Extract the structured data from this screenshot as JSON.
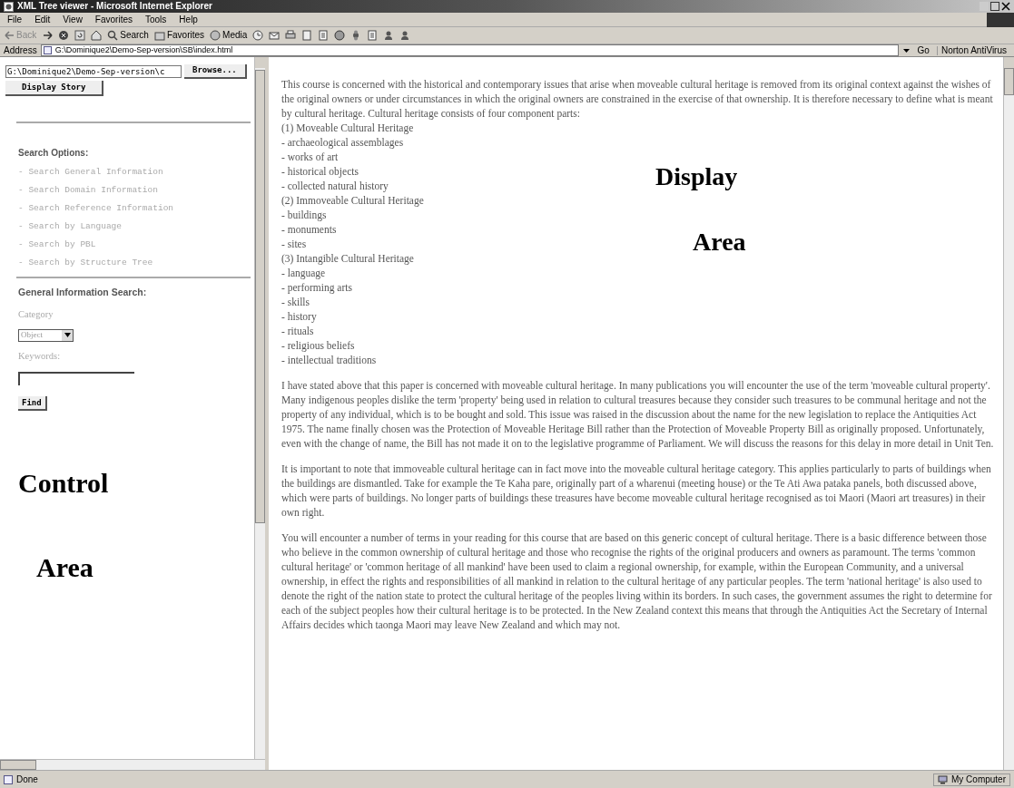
{
  "window": {
    "title": "XML Tree viewer - Microsoft Internet Explorer"
  },
  "menu": [
    "File",
    "Edit",
    "View",
    "Favorites",
    "Tools",
    "Help"
  ],
  "toolbar": [
    {
      "kind": "back",
      "label": "Back"
    },
    {
      "kind": "forward"
    },
    {
      "kind": "stop"
    },
    {
      "kind": "refresh"
    },
    {
      "kind": "home"
    },
    {
      "kind": "search",
      "label": "Search"
    },
    {
      "kind": "favorites",
      "label": "Favorites"
    },
    {
      "kind": "media",
      "label": "Media"
    },
    {
      "kind": "history"
    },
    {
      "kind": "mail"
    },
    {
      "kind": "print"
    },
    {
      "kind": "edit"
    },
    {
      "kind": "page"
    },
    {
      "kind": "globe"
    },
    {
      "kind": "flower"
    },
    {
      "kind": "page"
    },
    {
      "kind": "person"
    },
    {
      "kind": "person"
    }
  ],
  "address": {
    "label": "Address",
    "value": "G:\\Dominique2\\Demo-Sep-version\\SB\\index.html",
    "go": "Go",
    "extra": "Norton AntiVirus"
  },
  "control_frame": {
    "file_field": "G:\\Dominique2\\Demo-Sep-version\\c",
    "browse": "Browse...",
    "display_story": "Display Story",
    "search_options": {
      "heading": "Search Options:",
      "items": [
        "- Search General Information",
        "- Search Domain Information",
        "- Search Reference Information",
        "- Search by Language",
        "- Search by PBL",
        "- Search by Structure Tree"
      ]
    },
    "general_search": {
      "heading": "General Information Search:",
      "category_label": "Category",
      "category_value": "Object",
      "keywords_label": "Keywords:",
      "find": "Find"
    }
  },
  "display_frame": {
    "intro": "This course is concerned with the historical and contemporary issues that arise when moveable cultural heritage is removed from its original context against the wishes of the original owners or under circumstances in which the original owners are constrained in the exercise of that ownership. It is therefore necessary to define what is meant by cultural heritage. Cultural heritage consists of four component parts:",
    "list": [
      "(1) Moveable Cultural Heritage",
      "- archaeological assemblages",
      "- works of art",
      "- historical objects",
      "- collected natural history",
      "(2) Immoveable Cultural Heritage",
      "- buildings",
      "- monuments",
      "- sites",
      "(3) Intangible Cultural Heritage",
      "- language",
      "- performing arts",
      "- skills",
      "- history",
      "- rituals",
      "- religious beliefs",
      "- intellectual traditions"
    ],
    "paragraphs": [
      "I have stated above that this paper is concerned with moveable cultural heritage. In many publications you will encounter the use of the term 'moveable cultural property'. Many indigenous peoples dislike the term 'property' being used in relation to cultural treasures because they consider such treasures to be communal heritage and not the property of any individual, which is to be bought and sold. This issue was raised in the discussion about the name for the new legislation to replace the Antiquities Act 1975. The name finally chosen was the Protection of Moveable Heritage Bill rather than the Protection of Moveable Property Bill as originally proposed. Unfortunately, even with the change of name, the Bill has not made it on to the legislative programme of Parliament. We will discuss the reasons for this delay in more detail in Unit Ten.",
      "It is important to note that immoveable cultural heritage can in fact move into the moveable cultural heritage category. This applies particularly to parts of buildings when the buildings are dismantled. Take for example the Te Kaha pare, originally part of a wharenui (meeting house) or the Te Ati Awa pataka panels, both discussed above, which were parts of buildings. No longer parts of buildings these treasures have become moveable cultural heritage recognised as toi Maori (Maori art treasures) in their own right.",
      "You will encounter a number of terms in your reading for this course that are based on this generic concept of cultural heritage. There is a basic difference between those who believe in the common ownership of cultural heritage and those who recognise the rights of the original producers and owners as paramount. The terms 'common cultural heritage' or 'common heritage of all mankind' have been used to claim a regional ownership, for example, within the European Community, and a universal ownership, in effect the rights and responsibilities of all mankind in relation to the cultural heritage of any particular peoples. The term 'national heritage' is also used to denote the right of the nation state to protect the cultural heritage of the peoples living within its borders. In such cases, the government assumes the right to determine for each of the subject peoples how their cultural heritage is to be protected. In the New Zealand context this means that through the Antiquities Act the Secretary of Internal Affairs decides which taonga Maori may leave New Zealand and which may not."
    ]
  },
  "annotations": [
    {
      "kind": "display",
      "lines": [
        "Display",
        "Area"
      ]
    },
    {
      "kind": "control",
      "lines": [
        "Control",
        "Area"
      ]
    }
  ],
  "status_bar": {
    "text": "Done",
    "zone": "My Computer"
  }
}
